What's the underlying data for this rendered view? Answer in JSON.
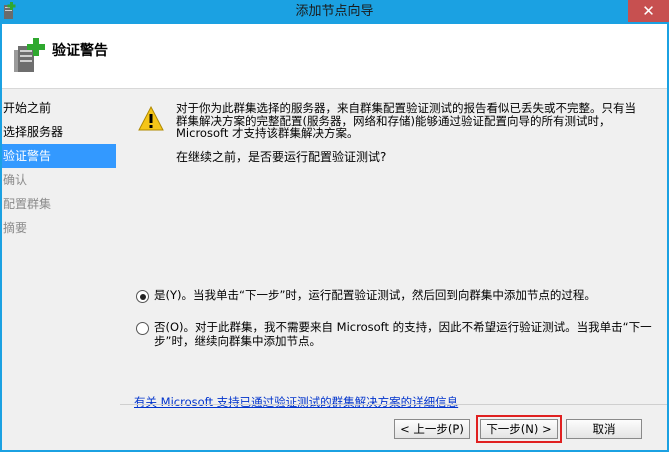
{
  "window": {
    "title": "添加节点向导",
    "close_glyph": "✕"
  },
  "header": {
    "title": "验证警告"
  },
  "nav": {
    "items": [
      {
        "label": "开始之前",
        "state": "normal"
      },
      {
        "label": "选择服务器",
        "state": "normal"
      },
      {
        "label": "验证警告",
        "state": "selected"
      },
      {
        "label": "确认",
        "state": "disabled"
      },
      {
        "label": "配置群集",
        "state": "disabled"
      },
      {
        "label": "摘要",
        "state": "disabled"
      }
    ]
  },
  "content": {
    "warning_text": "对于你为此群集选择的服务器，来自群集配置验证测试的报告看似已丢失或不完整。只有当群集解决方案的完整配置(服务器，网络和存储)能够通过验证配置向导的所有测试时，Microsoft 才支持该群集解决方案。",
    "question": "在继续之前，是否要运行配置验证测试?",
    "option_yes": "是(Y)。当我单击“下一步”时，运行配置验证测试，然后回到向群集中添加节点的过程。",
    "option_no": "否(O)。对于此群集，我不需要来自 Microsoft 的支持，因此不希望运行验证测试。当我单击“下一步”时，继续向群集中添加节点。",
    "selected_option": "yes",
    "info_link": "有关 Microsoft 支持已通过验证测试的群集解决方案的详细信息"
  },
  "footer": {
    "prev_label": "< 上一步(P)",
    "next_label": "下一步(N) >",
    "cancel_label": "取消"
  },
  "colors": {
    "title_bar": "#1ba1e2",
    "selected_nav": "#3399ff",
    "highlight_outline": "#e02020",
    "link": "#0033cc"
  }
}
